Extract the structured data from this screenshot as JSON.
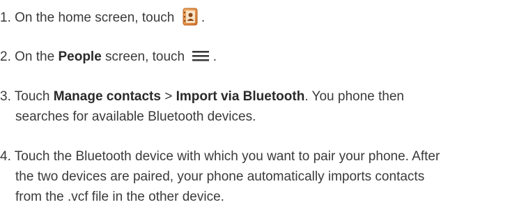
{
  "steps": [
    {
      "number": "1.",
      "text_before": "On the home screen, touch",
      "icon": "contacts-app-icon",
      "text_after": "."
    },
    {
      "number": "2.",
      "text_before": "On the ",
      "bold": "People",
      "text_middle": " screen, touch",
      "icon": "menu-icon",
      "text_after": "."
    },
    {
      "number": "3.",
      "text_before": "Touch ",
      "bold1": "Manage contacts",
      "sep": " > ",
      "bold2": "Import via Bluetooth",
      "text_after_line1": ". You phone then",
      "line2": "searches for available Bluetooth devices."
    },
    {
      "number": "4.",
      "line1": "Touch the Bluetooth device with which you want to pair your phone. After",
      "line2": "the two devices are paired, your phone automatically imports contacts",
      "line3": "from the .vcf file in the other device."
    }
  ],
  "colors": {
    "text": "#3a3a3a",
    "icon_orange": "#e08a3c",
    "icon_menu": "#3a3a3a"
  }
}
